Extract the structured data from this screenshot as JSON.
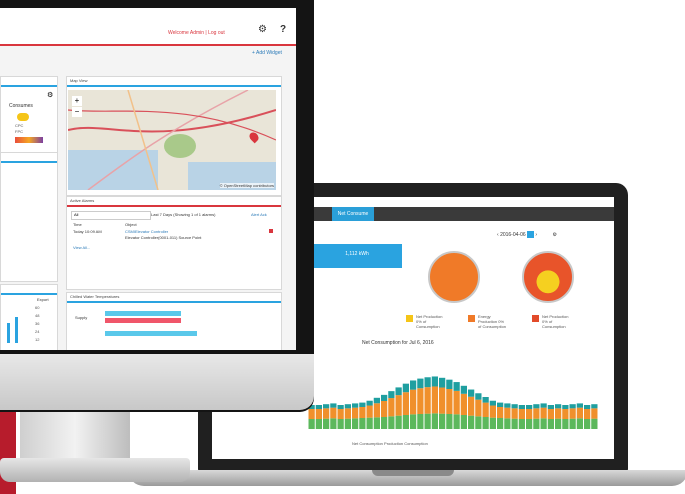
{
  "monitor_app": {
    "header": {
      "welcome": "Welcome Admin  |  Log out",
      "gear_icon": "gear-icon",
      "help_icon": "help-icon",
      "help_label": "?"
    },
    "add_widget": "+ Add Widget",
    "left_panel": {
      "title": "Consumes",
      "items": [
        "CPC",
        "FPC"
      ]
    },
    "map_widget": {
      "title": "Map View",
      "zoom_in": "+",
      "zoom_out": "−",
      "attribution": "© OpenStreetMap contributors"
    },
    "alarms_widget": {
      "title": "Active Alarms",
      "filter_value": "All",
      "range_text": "Last 7 Days (Showing 1 of 1 alarms)",
      "ack_all": "Alert Ack",
      "columns": [
        "Time",
        "Object"
      ],
      "rows": [
        {
          "time": "Today 10:09 AM",
          "object": "CSMIElevator Controller",
          "detail": "Elevator Controller(0001-011) Source Point"
        }
      ],
      "view_all": "View All..."
    },
    "temperature_widget": {
      "title": "Chilled Water Temperatures",
      "label": "Supply",
      "values": [
        85,
        85
      ]
    },
    "side_chart": {
      "label": "Export",
      "ticks": [
        "60",
        "48",
        "36",
        "24",
        "12"
      ]
    }
  },
  "laptop_app": {
    "active_tab": "Net Consume",
    "date": "2016-04-06",
    "banner_value": "1,112 kWh",
    "legend_items": [
      {
        "label": "Net Production 0% of Consumption",
        "color": "#f5c518"
      },
      {
        "label": "Energy Production 0% of Consumption",
        "color": "#f07a28"
      },
      {
        "label": "Net Production 0% of Consumption",
        "color": "#e24b2a"
      }
    ],
    "chart_title": "Net Consumption for Jul 6, 2016",
    "bottom_legend": [
      "Net Consumption",
      "Production",
      "Consumption"
    ],
    "colors": {
      "accent": "#2aa3e0",
      "orange": "#f0902c",
      "green": "#5cb85c",
      "teal": "#1f9fa0"
    }
  },
  "chart_data": {
    "type": "bar",
    "title": "Net Consumption for Jul 6, 2016",
    "series": [
      {
        "name": "Net Consumption",
        "values": [
          30,
          30,
          31,
          32,
          30,
          31,
          32,
          33,
          34,
          35,
          36,
          38,
          40,
          42,
          44,
          45,
          46,
          47,
          46,
          45,
          44,
          42,
          40,
          38,
          36,
          34,
          33,
          32,
          31,
          30,
          30,
          31,
          32,
          30,
          31,
          30,
          31,
          32,
          30,
          31
        ]
      },
      {
        "name": "Production",
        "values": [
          0,
          0,
          0,
          0,
          0,
          0,
          0,
          0,
          2,
          6,
          10,
          14,
          18,
          22,
          25,
          27,
          28,
          28,
          27,
          25,
          22,
          18,
          14,
          10,
          6,
          2,
          0,
          0,
          0,
          0,
          0,
          0,
          0,
          0,
          0,
          0,
          0,
          0,
          0,
          0
        ]
      },
      {
        "name": "Consumption",
        "values": [
          30,
          30,
          31,
          32,
          30,
          31,
          32,
          33,
          36,
          41,
          46,
          52,
          58,
          64,
          69,
          72,
          74,
          75,
          73,
          70,
          66,
          60,
          54,
          48,
          42,
          36,
          33,
          32,
          31,
          30,
          30,
          31,
          32,
          30,
          31,
          30,
          31,
          32,
          30,
          31
        ]
      }
    ]
  }
}
